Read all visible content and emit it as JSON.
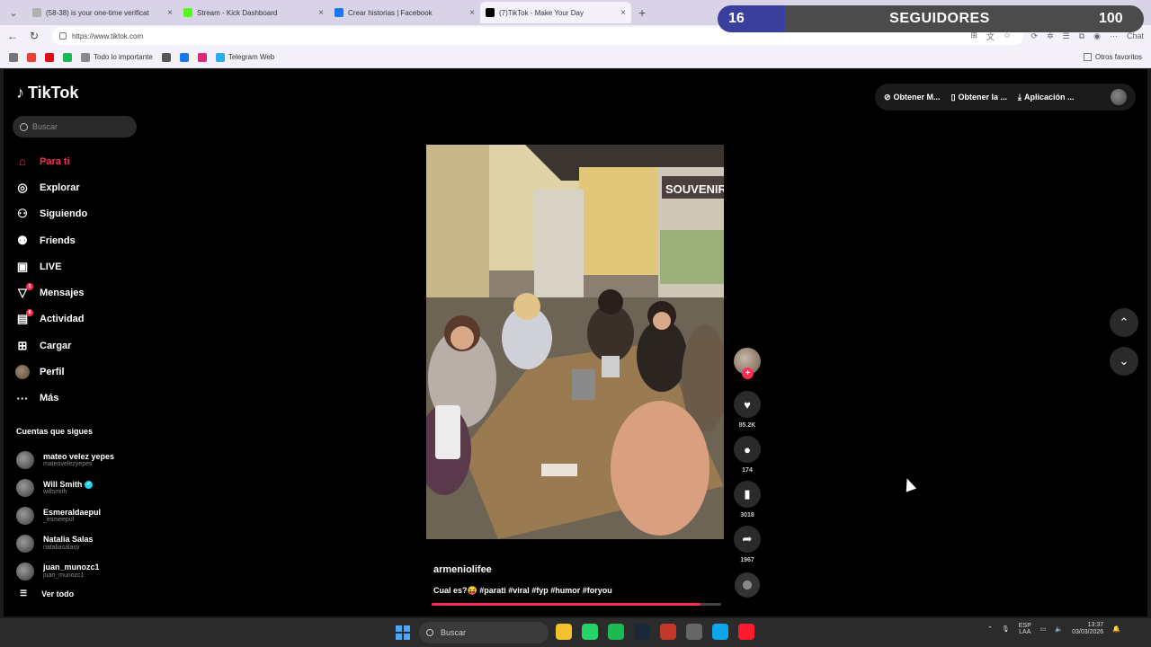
{
  "browser": {
    "tabs": [
      {
        "title": "(58-38) is your one-time verificat",
        "color": "#b0b0b0",
        "active": false
      },
      {
        "title": "Stream - Kick Dashboard",
        "color": "#53fc18",
        "active": false
      },
      {
        "title": "Crear historias | Facebook",
        "color": "#1877f2",
        "active": false
      },
      {
        "title": "(7)TikTok - Make Your Day",
        "color": "#000000",
        "active": true
      }
    ],
    "url": "https://www.tiktok.com",
    "bookmarks": [
      {
        "label": "",
        "color": "#777777",
        "name": "bookmark-cloud-icon"
      },
      {
        "label": "",
        "color": "#ea4335",
        "name": "bookmark-gmail-icon"
      },
      {
        "label": "",
        "color": "#e50914",
        "name": "bookmark-netflix-icon"
      },
      {
        "label": "",
        "color": "#1db954",
        "name": "bookmark-spotify-icon"
      },
      {
        "label": "Todo lo importante",
        "color": "#8a8a8a",
        "name": "bookmark-folder-icon"
      },
      {
        "label": "",
        "color": "#555555",
        "name": "bookmark-guitar-icon"
      },
      {
        "label": "",
        "color": "#1877f2",
        "name": "bookmark-facebook-icon"
      },
      {
        "label": "",
        "color": "#d62976",
        "name": "bookmark-instagram-icon"
      },
      {
        "label": "Telegram Web",
        "color": "#2aabee",
        "name": "bookmark-telegram-icon"
      }
    ],
    "other_bookmarks": "Otros favoritos",
    "chat_label": "Chat"
  },
  "followers_overlay": {
    "current": "16",
    "label": "SEGUIDORES",
    "goal": "100",
    "progress": 0.16
  },
  "tiktok": {
    "logo": "TikTok",
    "search_placeholder": "Buscar",
    "nav": [
      {
        "label": "Para ti",
        "icon": "home-icon",
        "glyph": "⌂",
        "active": true,
        "badge": ""
      },
      {
        "label": "Explorar",
        "icon": "compass-icon",
        "glyph": "◎",
        "active": false,
        "badge": ""
      },
      {
        "label": "Siguiendo",
        "icon": "following-icon",
        "glyph": "⚇",
        "active": false,
        "badge": ""
      },
      {
        "label": "Friends",
        "icon": "friends-icon",
        "glyph": "⚉",
        "active": false,
        "badge": ""
      },
      {
        "label": "LIVE",
        "icon": "live-icon",
        "glyph": "▣",
        "active": false,
        "badge": ""
      },
      {
        "label": "Mensajes",
        "icon": "messages-icon",
        "glyph": "▽",
        "active": false,
        "badge": "1"
      },
      {
        "label": "Actividad",
        "icon": "activity-icon",
        "glyph": "▤",
        "active": false,
        "badge": "6"
      },
      {
        "label": "Cargar",
        "icon": "upload-icon",
        "glyph": "⊞",
        "active": false,
        "badge": ""
      },
      {
        "label": "Perfil",
        "icon": "profile-avatar",
        "glyph": "",
        "active": false,
        "badge": ""
      },
      {
        "label": "Más",
        "icon": "more-icon",
        "glyph": "···",
        "active": false,
        "badge": ""
      }
    ],
    "following_title": "Cuentas que sigues",
    "following": [
      {
        "name": "mateo velez yepes",
        "user": "mateovelezyepes",
        "verified": false
      },
      {
        "name": "Will Smith",
        "user": "willsmith",
        "verified": true
      },
      {
        "name": "Esmeraldaepul",
        "user": "_esmeepul",
        "verified": false
      },
      {
        "name": "Natalia Salas",
        "user": "nataliasalasv",
        "verified": false
      },
      {
        "name": "juan_munozc1",
        "user": "juan_munozc1",
        "verified": false
      }
    ],
    "see_all": "Ver todo",
    "top_actions": [
      "Obtener M...",
      "Obtener la ...",
      "Aplicación ..."
    ],
    "video": {
      "username": "armeniolifee",
      "description": "Cual es?😝 #parati #viral #fyp #humor #foryou",
      "progress": 0.93,
      "likes": "85.2K",
      "comments": "174",
      "saves": "3018",
      "shares": "1967",
      "storefront_sign": "SOUVENIR"
    }
  },
  "taskbar": {
    "search": "Buscar",
    "apps": [
      {
        "name": "taskbar-files-icon",
        "color": "#f2c12e"
      },
      {
        "name": "taskbar-whatsapp-icon",
        "color": "#25d366"
      },
      {
        "name": "taskbar-spotify-icon",
        "color": "#1db954"
      },
      {
        "name": "taskbar-steam-icon",
        "color": "#1b2838"
      },
      {
        "name": "taskbar-app-red-icon",
        "color": "#c0392b"
      },
      {
        "name": "taskbar-settings-icon",
        "color": "#666666"
      },
      {
        "name": "taskbar-edge-icon",
        "color": "#0fa5e9"
      },
      {
        "name": "taskbar-opera-icon",
        "color": "#ff1b2d"
      }
    ],
    "lang_top": "ESP",
    "lang_bottom": "LAA",
    "time": "13:37",
    "date": "03/03/2026"
  }
}
